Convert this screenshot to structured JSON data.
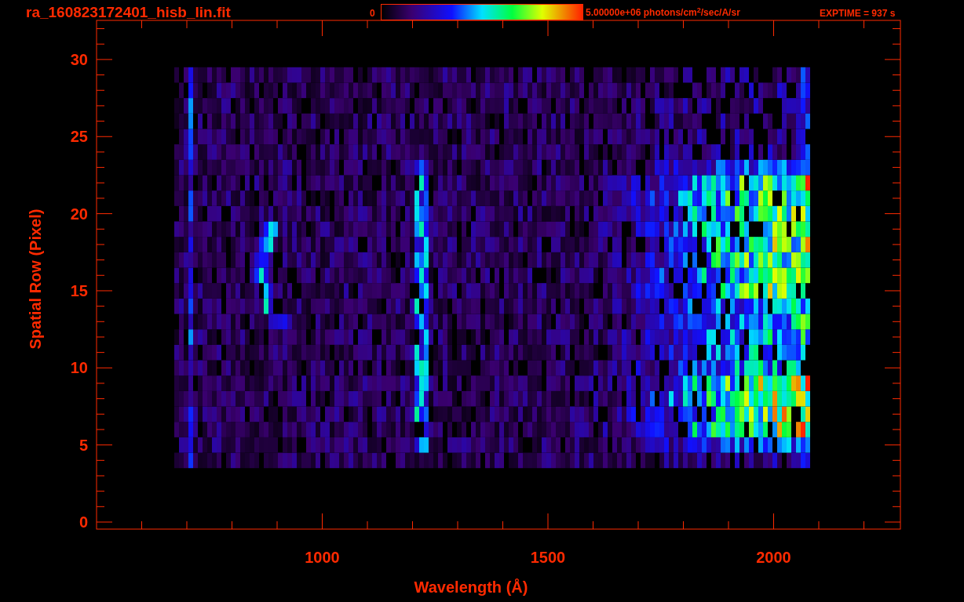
{
  "title": "ra_160823172401_hisb_lin.fit",
  "colorbar": {
    "min_label": "0",
    "max_label": "5.00000e+06 photons/cm$^{2}$/sec/A/sr"
  },
  "exposure": "EXPTIME = 937 s",
  "x_axis": {
    "label": "Wavelength (Å)",
    "tick_labels": [
      "1000",
      "1500",
      "2000"
    ]
  },
  "y_axis": {
    "label": "Spatial Row (Pixel)",
    "tick_labels": [
      "30",
      "25",
      "20",
      "15",
      "10",
      "5",
      "0"
    ]
  }
}
